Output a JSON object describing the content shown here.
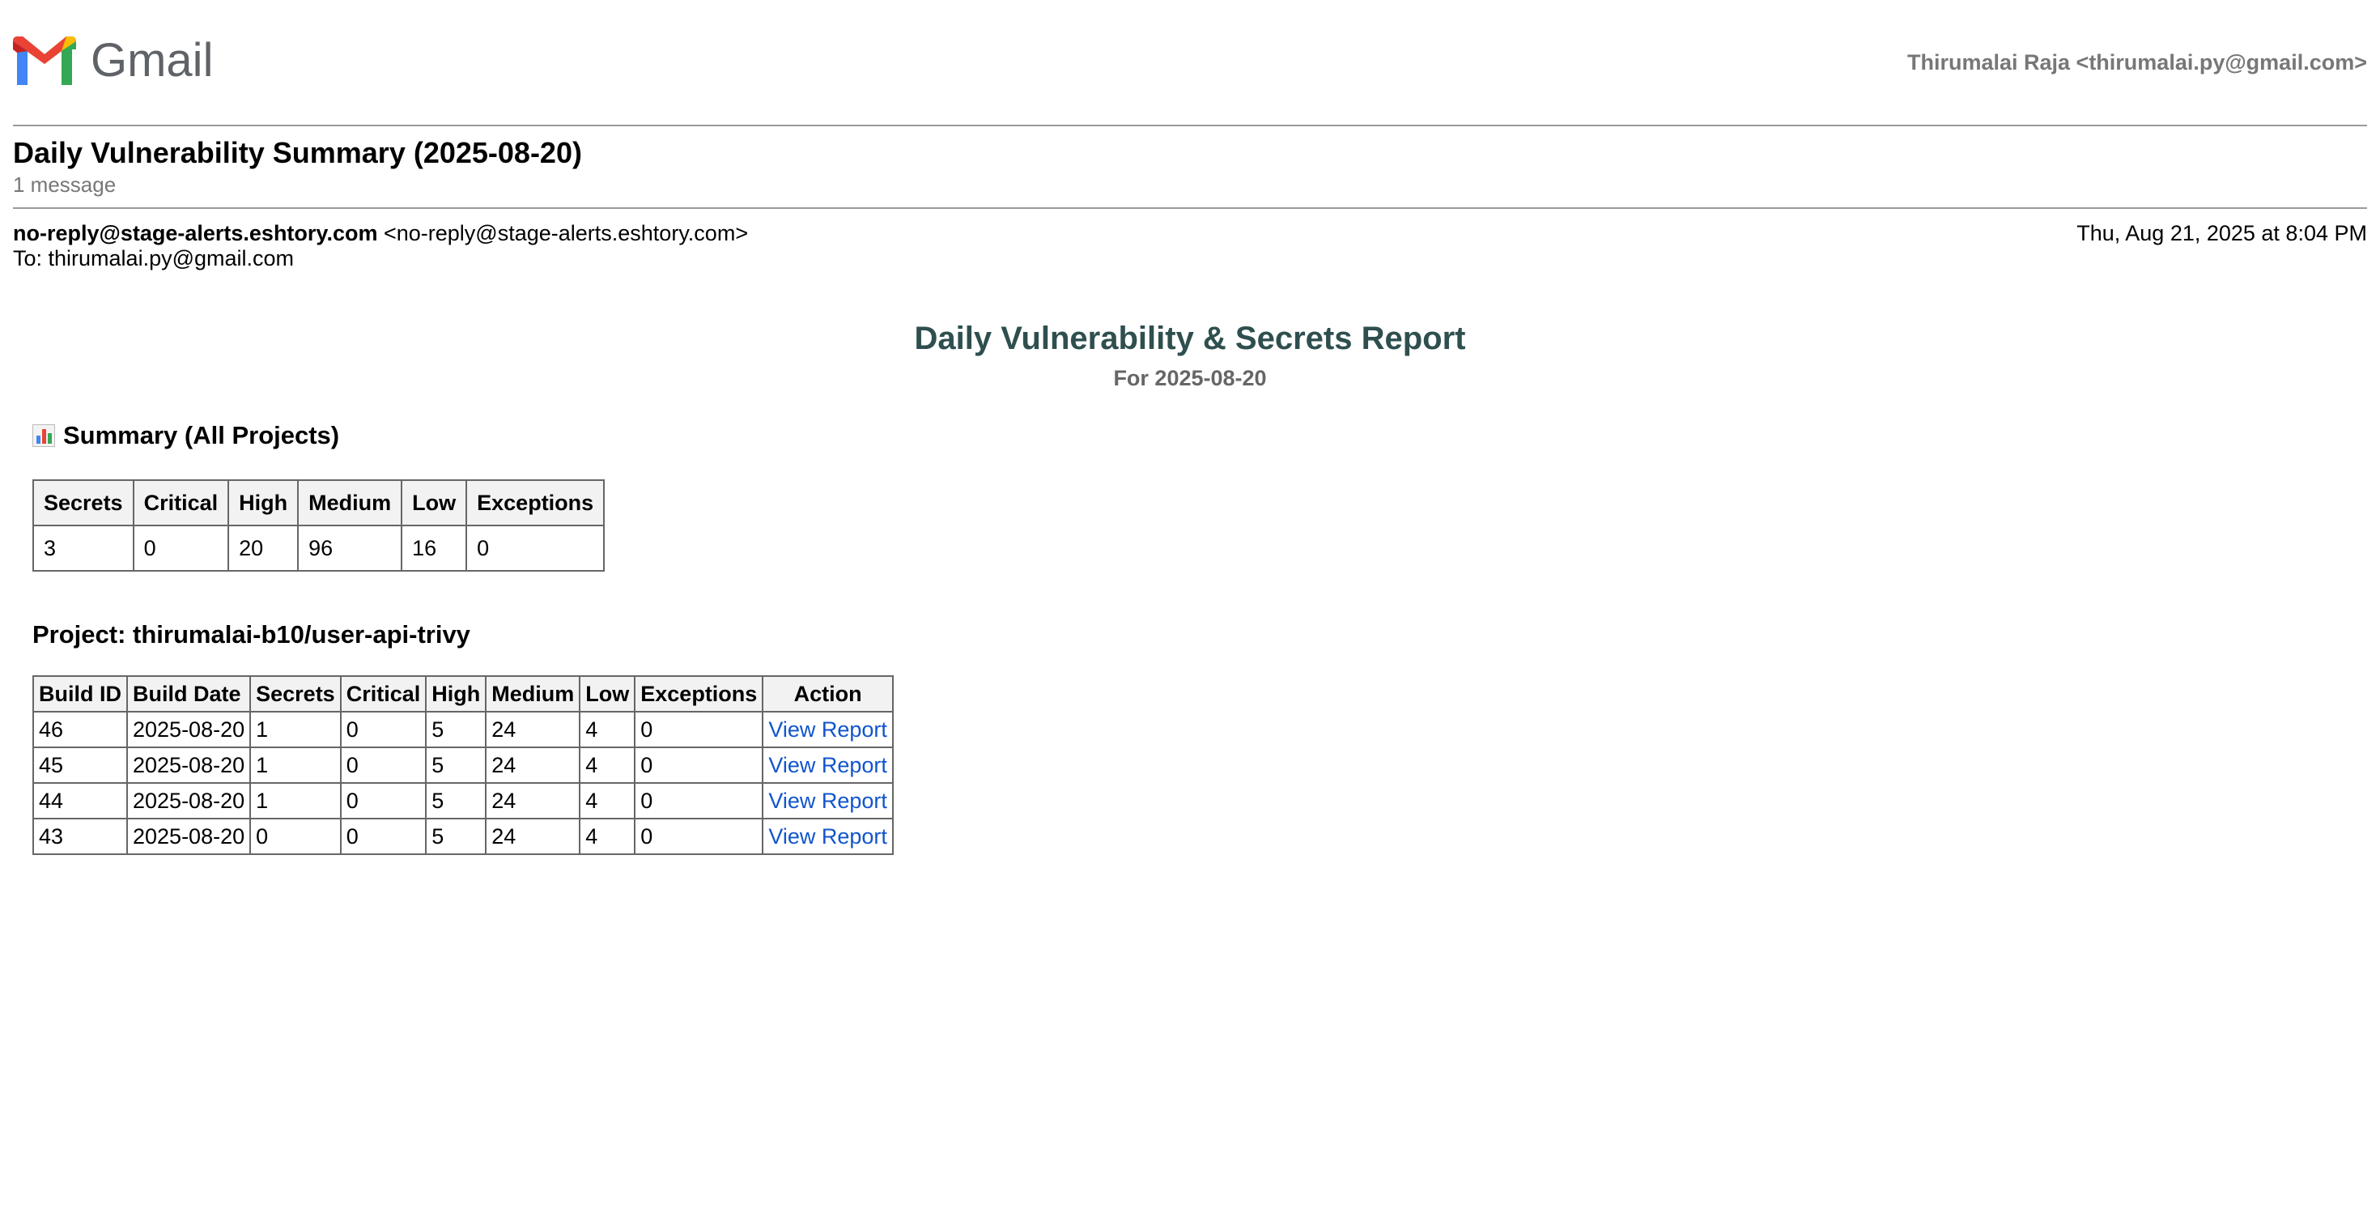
{
  "app": {
    "brand": "Gmail",
    "account": "Thirumalai Raja <thirumalai.py@gmail.com>"
  },
  "thread": {
    "subject": "Daily Vulnerability Summary (2025-08-20)",
    "message_count": "1 message"
  },
  "message": {
    "from_name": "no-reply@stage-alerts.eshtory.com",
    "from_address": "<no-reply@stage-alerts.eshtory.com>",
    "date": "Thu, Aug 21, 2025 at 8:04 PM",
    "to": "To: thirumalai.py@gmail.com"
  },
  "report": {
    "title": "Daily Vulnerability & Secrets Report",
    "subtitle": "For 2025-08-20",
    "summary": {
      "heading": "Summary (All Projects)",
      "columns": [
        "Secrets",
        "Critical",
        "High",
        "Medium",
        "Low",
        "Exceptions"
      ],
      "values": [
        "3",
        "0",
        "20",
        "96",
        "16",
        "0"
      ]
    },
    "project": {
      "heading": "Project: thirumalai-b10/user-api-trivy",
      "columns": [
        "Build ID",
        "Build Date",
        "Secrets",
        "Critical",
        "High",
        "Medium",
        "Low",
        "Exceptions",
        "Action"
      ],
      "rows": [
        [
          "46",
          "2025-08-20",
          "1",
          "0",
          "5",
          "24",
          "4",
          "0",
          "View Report"
        ],
        [
          "45",
          "2025-08-20",
          "1",
          "0",
          "5",
          "24",
          "4",
          "0",
          "View Report"
        ],
        [
          "44",
          "2025-08-20",
          "1",
          "0",
          "5",
          "24",
          "4",
          "0",
          "View Report"
        ],
        [
          "43",
          "2025-08-20",
          "0",
          "0",
          "5",
          "24",
          "4",
          "0",
          "View Report"
        ]
      ]
    }
  },
  "colors": {
    "title": "#2f4f4f",
    "muted": "#777777",
    "link": "#1155cc",
    "header_bg": "#f2f2f2",
    "border": "#666666"
  }
}
